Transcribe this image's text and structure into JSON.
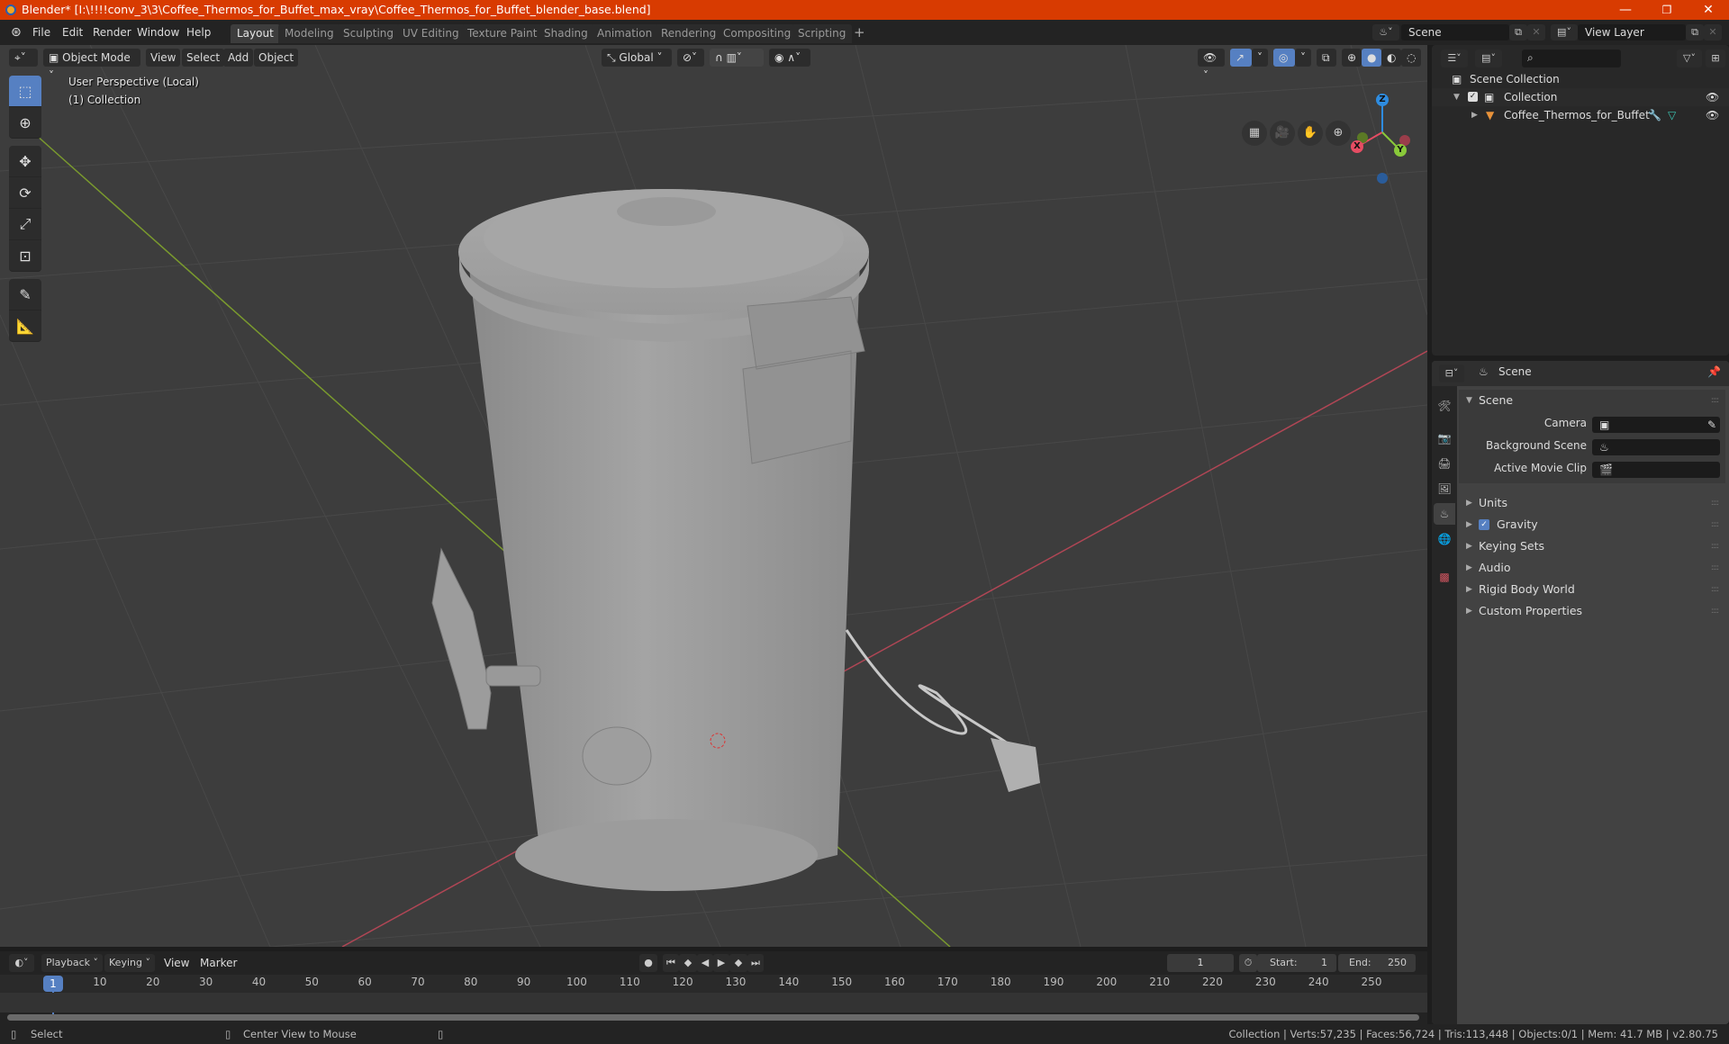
{
  "window": {
    "title": "Blender* [I:\\!!!!conv_3\\3\\Coffee_Thermos_for_Buffet_max_vray\\Coffee_Thermos_for_Buffet_blender_base.blend]",
    "minimize": "—",
    "maximize": "❐",
    "close": "✕"
  },
  "menubar": {
    "items": [
      "File",
      "Edit",
      "Render",
      "Window",
      "Help"
    ]
  },
  "workspaces": {
    "tabs": [
      "Layout",
      "Modeling",
      "Sculpting",
      "UV Editing",
      "Texture Paint",
      "Shading",
      "Animation",
      "Rendering",
      "Compositing",
      "Scripting"
    ],
    "active": "Layout",
    "add": "+"
  },
  "scene_selector": {
    "value": "Scene"
  },
  "viewlayer_selector": {
    "value": "View Layer"
  },
  "viewport_header": {
    "mode": "Object Mode",
    "menus": [
      "View",
      "Select",
      "Add",
      "Object"
    ],
    "orientation": "Global"
  },
  "viewport": {
    "perspective_label": "User Perspective (Local)",
    "collection_label": "(1) Collection",
    "gizmo": {
      "x": "X",
      "y": "Y",
      "z": "Z"
    },
    "colors": {
      "x": "#e64d63",
      "y": "#89c93a",
      "z": "#2e8ce0",
      "background": "#3d3d3d",
      "object": "#9a9a9a"
    }
  },
  "outliner": {
    "search_placeholder": "",
    "root": "Scene Collection",
    "collection": "Collection",
    "object": "Coffee_Thermos_for_Buffet"
  },
  "properties": {
    "header_title": "Scene",
    "panel_title": "Scene",
    "fields": [
      {
        "label": "Camera",
        "value": ""
      },
      {
        "label": "Background Scene",
        "value": ""
      },
      {
        "label": "Active Movie Clip",
        "value": ""
      }
    ],
    "subpanels": [
      "Units",
      "Gravity",
      "Keying Sets",
      "Audio",
      "Rigid Body World",
      "Custom Properties"
    ],
    "gravity_checked": true
  },
  "timeline": {
    "menus": [
      "Playback",
      "Keying",
      "View",
      "Marker"
    ],
    "current_frame": "1",
    "start_label": "Start:",
    "start": "1",
    "end_label": "End:",
    "end": "250",
    "ticks": [
      "10",
      "20",
      "30",
      "40",
      "50",
      "60",
      "70",
      "80",
      "90",
      "100",
      "110",
      "120",
      "130",
      "140",
      "150",
      "160",
      "170",
      "180",
      "190",
      "200",
      "210",
      "220",
      "230",
      "240",
      "250"
    ],
    "playhead": "1"
  },
  "statusbar": {
    "left_action": "Select",
    "middle_action": "Center View to Mouse",
    "stats": "Collection | Verts:57,235 | Faces:56,724 | Tris:113,448 | Objects:0/1 | Mem: 41.7 MB | v2.80.75"
  }
}
